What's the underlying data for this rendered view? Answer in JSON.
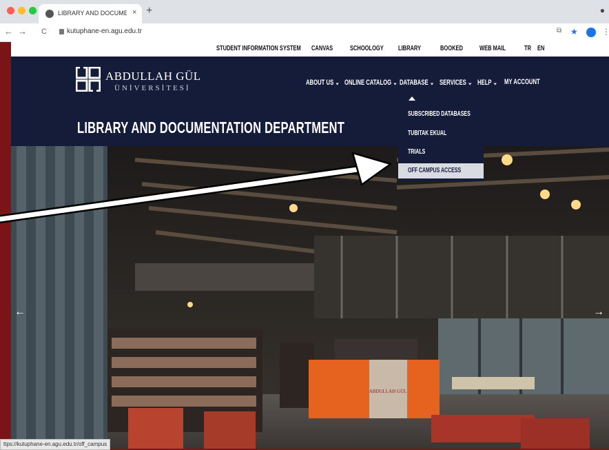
{
  "browser": {
    "tab_title": "LIBRARY AND DOCUMENTATIC",
    "tab_close": "×",
    "new_tab": "+",
    "url": "kutuphane-en.agu.edu.tr",
    "back": "←",
    "forward": "→",
    "reload": "C",
    "menu": "⋮",
    "status_url": "ttps://kutuphane-en.agu.edu.tr/off_campus"
  },
  "topnav": {
    "items": [
      "STUDENT INFORMATION SYSTEM",
      "CANVAS",
      "SCHOOLOGY",
      "LIBRARY",
      "BOOKED",
      "WEB MAIL",
      "TR",
      "EN"
    ]
  },
  "logo": {
    "name": "ABDULLAH GÜL",
    "sub": "ÜNİVERSİTESİ"
  },
  "mainnav": {
    "items": [
      "ABOUT US ⌄",
      "ONLINE CATALOG ⌄",
      "DATABASE ⌄",
      "SERVICES ⌄",
      "HELP ⌄",
      "MY ACCOUNT"
    ]
  },
  "department": "LIBRARY AND DOCUMENTATION DEPARTMENT",
  "dropdown": {
    "items": [
      "SUBSCRIBED DATABASES",
      "TUBITAK EKUAL",
      "TRIALS",
      "OFF CAMPUS ACCESS"
    ],
    "highlighted": "OFF CAMPUS ACCESS"
  },
  "hero": {
    "prev": "←",
    "next": "→",
    "desk_sign": "ABDULLAH GÜL"
  },
  "colors": {
    "brand_navy": "#141c3a",
    "frame_red": "#7a1416",
    "desk_orange": "#e5631f"
  }
}
